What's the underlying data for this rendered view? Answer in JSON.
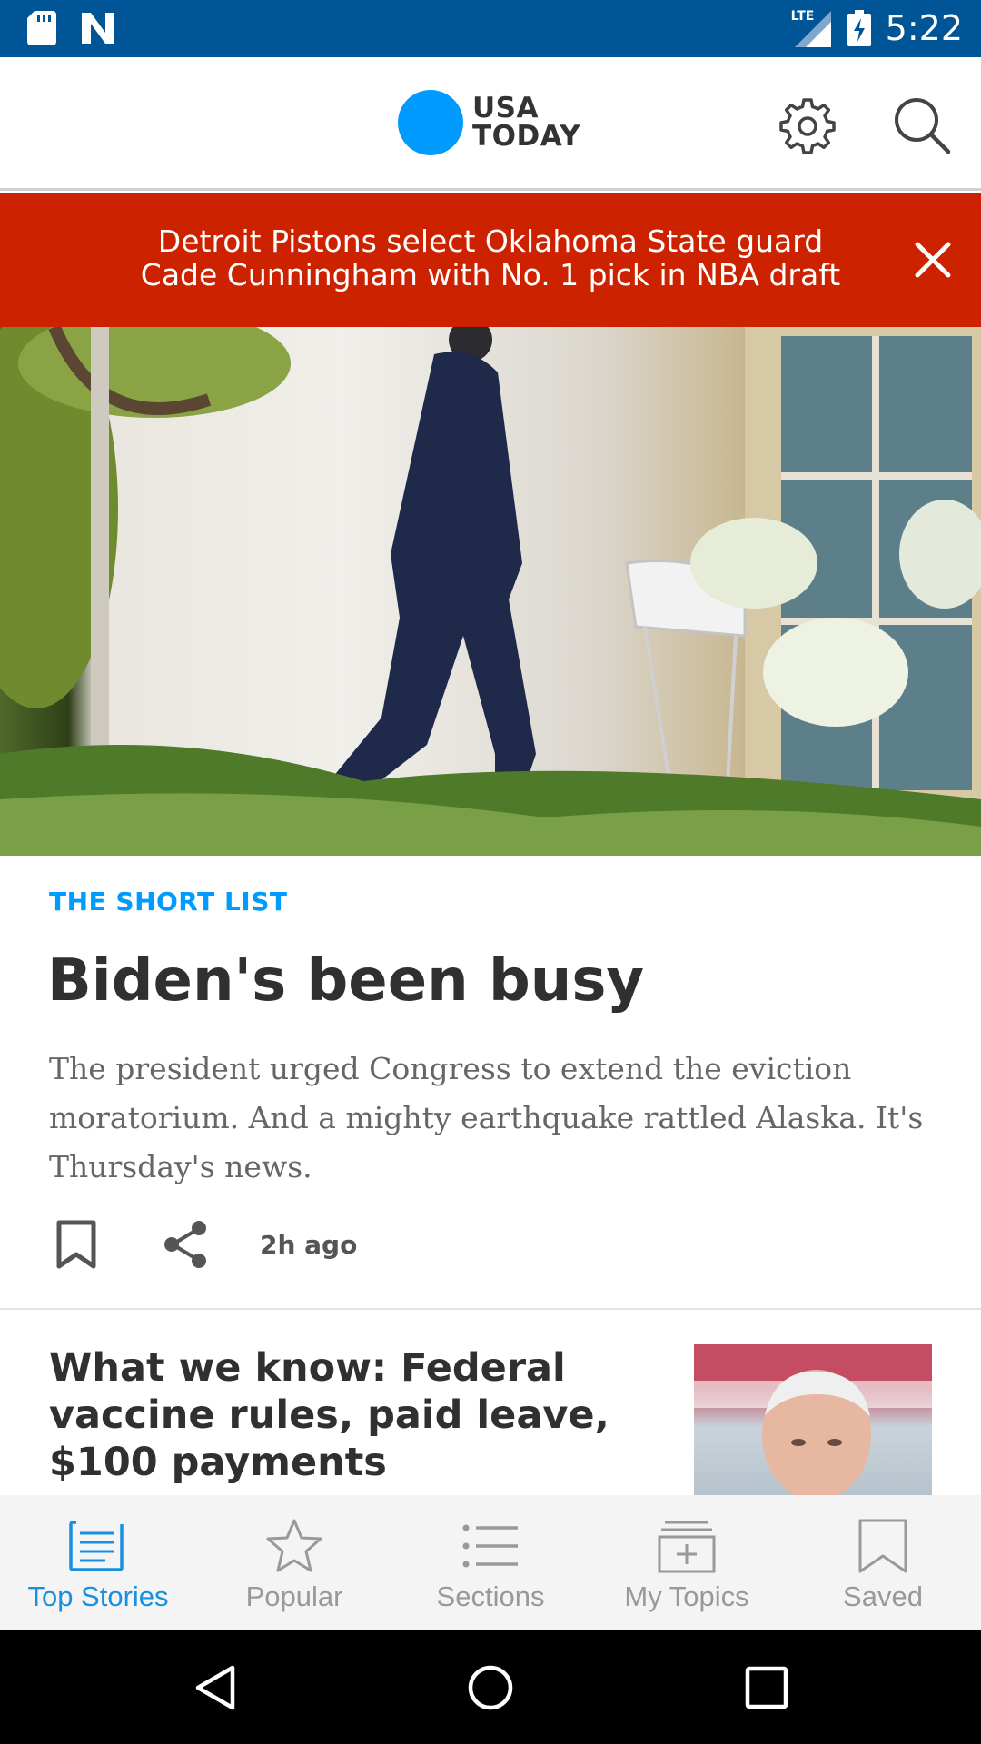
{
  "status_bar": {
    "time": "5:22",
    "network": "LTE",
    "icons": [
      "sd-card-icon",
      "n-notification-icon",
      "lte-signal-icon",
      "battery-charging-icon"
    ]
  },
  "header": {
    "logo_line1": "USA",
    "logo_line2": "TODAY",
    "logo_color": "#009bff",
    "settings_icon": "gear-icon",
    "search_icon": "search-icon"
  },
  "banner": {
    "line1": "Detroit Pistons select Oklahoma State guard",
    "line2": "Cade Cunningham with No. 1 pick in NBA draft",
    "close_icon": "close-icon",
    "color": "#cc2200"
  },
  "lead_story": {
    "kicker": "THE SHORT LIST",
    "headline": "Biden's been busy",
    "summary": "The president urged Congress to extend the eviction moratorium. And a mighty earthquake rattled Alaska. It's Thursday's news.",
    "age": "2h ago",
    "bookmark_icon": "bookmark-icon",
    "share_icon": "share-icon"
  },
  "story2": {
    "title": "What we know: Federal vaccine rules, paid leave, $100 payments"
  },
  "bottom_nav": {
    "items": [
      {
        "label": "Top Stories",
        "icon": "top-stories-icon",
        "active": true
      },
      {
        "label": "Popular",
        "icon": "star-icon",
        "active": false
      },
      {
        "label": "Sections",
        "icon": "list-icon",
        "active": false
      },
      {
        "label": "My Topics",
        "icon": "my-topics-icon",
        "active": false
      },
      {
        "label": "Saved",
        "icon": "bookmark-icon",
        "active": false
      }
    ],
    "active_color": "#1a8fe0",
    "inactive_color": "#999999"
  },
  "system_nav": {
    "back_icon": "back-icon",
    "home_icon": "home-icon",
    "recents_icon": "recents-icon"
  }
}
